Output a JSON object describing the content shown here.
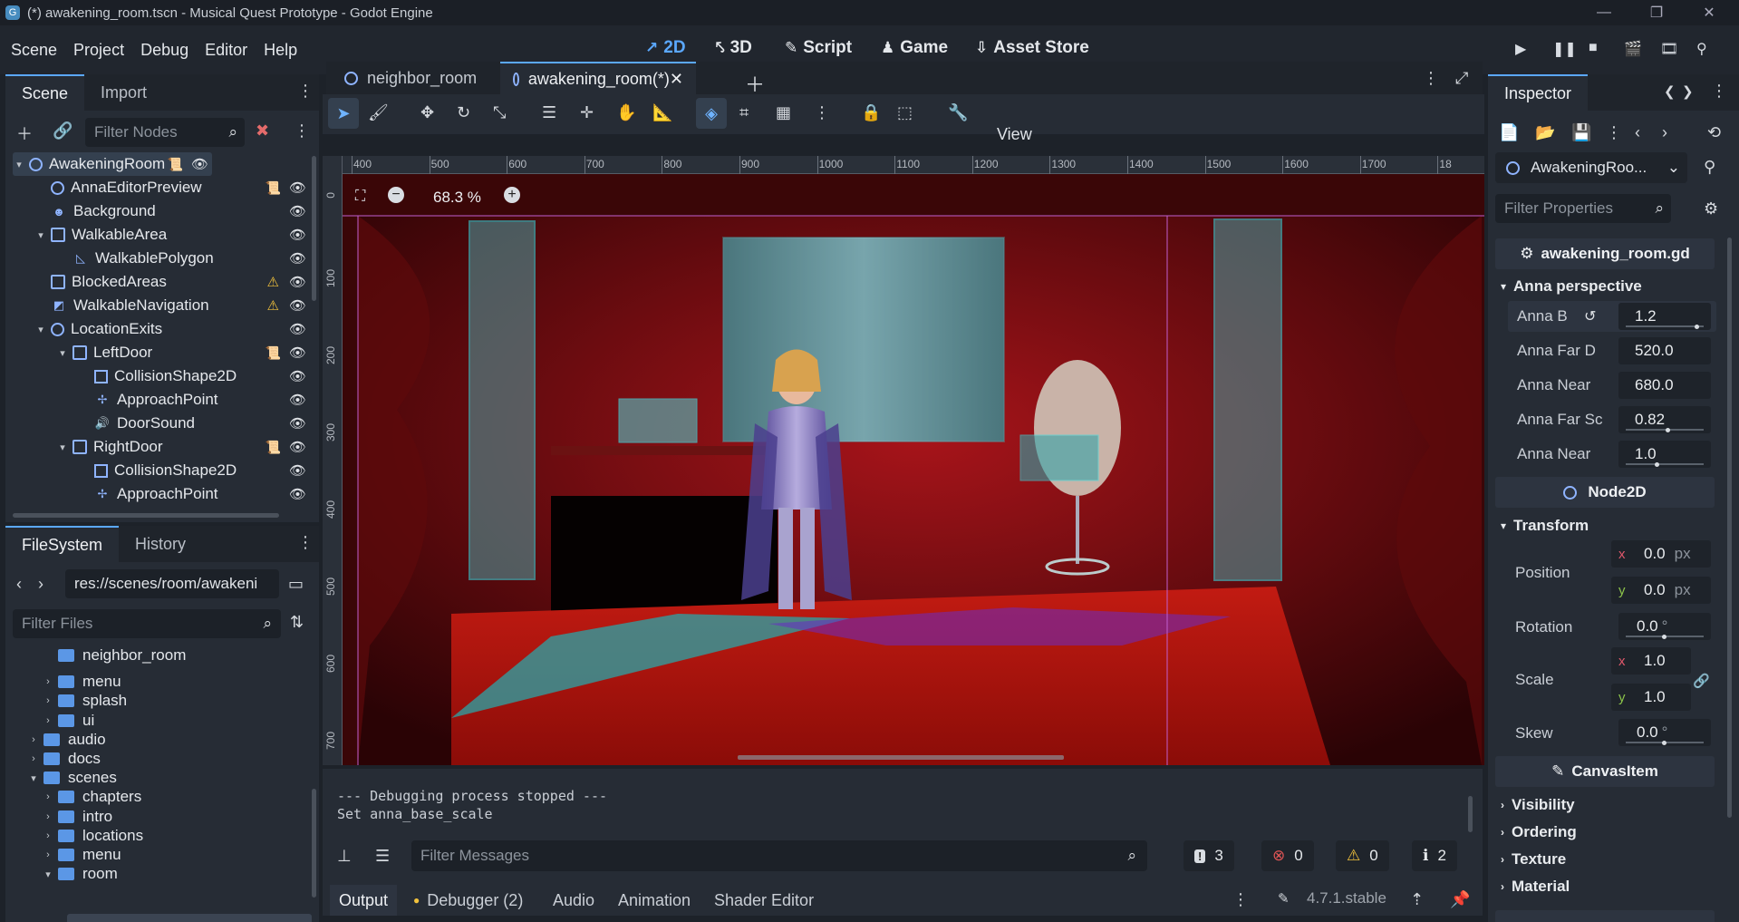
{
  "window": {
    "title": "(*) awakening_room.tscn - Musical Quest Prototype - Godot Engine"
  },
  "menu": [
    "Scene",
    "Project",
    "Debug",
    "Editor",
    "Help"
  ],
  "workspaces": [
    {
      "label": "2D",
      "glyph": "↗"
    },
    {
      "label": "3D",
      "glyph": "⤣"
    },
    {
      "label": "Script",
      "glyph": "✎"
    },
    {
      "label": "Game",
      "glyph": "♟"
    },
    {
      "label": "Asset Store",
      "glyph": "⇩"
    }
  ],
  "scene_dock": {
    "tabs": [
      "Scene",
      "Import"
    ],
    "filter_placeholder": "Filter Nodes",
    "nodes": [
      {
        "name": "AwakeningRoom",
        "depth": 0,
        "icon": "circle",
        "arrow": "▾",
        "script": true,
        "selected": true
      },
      {
        "name": "AnnaEditorPreview",
        "depth": 1,
        "icon": "circle",
        "script": true
      },
      {
        "name": "Background",
        "depth": 1,
        "icon": "sprite"
      },
      {
        "name": "WalkableArea",
        "depth": 1,
        "icon": "area",
        "arrow": "▾"
      },
      {
        "name": "WalkablePolygon",
        "depth": 2,
        "icon": "poly"
      },
      {
        "name": "BlockedAreas",
        "depth": 1,
        "icon": "area",
        "warn": true
      },
      {
        "name": "WalkableNavigation",
        "depth": 1,
        "icon": "nav",
        "warn": true
      },
      {
        "name": "LocationExits",
        "depth": 1,
        "icon": "circle",
        "arrow": "▾"
      },
      {
        "name": "LeftDoor",
        "depth": 2,
        "icon": "area",
        "arrow": "▾",
        "script": true
      },
      {
        "name": "CollisionShape2D",
        "depth": 3,
        "icon": "box"
      },
      {
        "name": "ApproachPoint",
        "depth": 3,
        "icon": "marker"
      },
      {
        "name": "DoorSound",
        "depth": 3,
        "icon": "sound"
      },
      {
        "name": "RightDoor",
        "depth": 2,
        "icon": "area",
        "arrow": "▾",
        "script": true
      },
      {
        "name": "CollisionShape2D",
        "depth": 3,
        "icon": "box"
      },
      {
        "name": "ApproachPoint",
        "depth": 3,
        "icon": "marker"
      }
    ]
  },
  "filesystem": {
    "tabs": [
      "FileSystem",
      "History"
    ],
    "path": "res://scenes/room/awakeni",
    "filter_placeholder": "Filter Files",
    "items": [
      {
        "name": "neighbor_room",
        "depth": 2,
        "arrow": ""
      },
      {
        "name": "menu",
        "depth": 2,
        "arrow": "›"
      },
      {
        "name": "splash",
        "depth": 2,
        "arrow": "›"
      },
      {
        "name": "ui",
        "depth": 2,
        "arrow": "›"
      },
      {
        "name": "audio",
        "depth": 1,
        "arrow": "›"
      },
      {
        "name": "docs",
        "depth": 1,
        "arrow": "›"
      },
      {
        "name": "scenes",
        "depth": 1,
        "arrow": "▾"
      },
      {
        "name": "chapters",
        "depth": 2,
        "arrow": "›"
      },
      {
        "name": "intro",
        "depth": 2,
        "arrow": "›"
      },
      {
        "name": "locations",
        "depth": 2,
        "arrow": "›"
      },
      {
        "name": "menu",
        "depth": 2,
        "arrow": "›"
      },
      {
        "name": "room",
        "depth": 2,
        "arrow": "▾"
      }
    ]
  },
  "editor_tabs": [
    {
      "label": "neighbor_room"
    },
    {
      "label": "awakening_room(*)",
      "active": true
    }
  ],
  "toolbar": {
    "view_label": "View",
    "zoom": "68.3 %"
  },
  "ruler": {
    "h": [
      "400",
      "500",
      "600",
      "700",
      "800",
      "900",
      "1000",
      "1100",
      "1200",
      "1300",
      "1400",
      "1500",
      "1600",
      "1700",
      "18"
    ],
    "v": [
      "0",
      "100",
      "200",
      "300",
      "400",
      "500",
      "600",
      "700"
    ]
  },
  "output": {
    "lines": [
      "--- Debugging process stopped ---",
      "Set anna_base_scale"
    ],
    "filter_placeholder": "Filter Messages",
    "counts": {
      "messages": "3",
      "errors": "0",
      "warnings": "0",
      "info": "2"
    }
  },
  "bottom_tabs": [
    "Output",
    "Debugger (2)",
    "Audio",
    "Animation",
    "Shader Editor"
  ],
  "version": "4.7.1.stable",
  "inspector": {
    "tab": "Inspector",
    "object": "AwakeningRoo...",
    "filter_placeholder": "Filter Properties",
    "script": "awakening_room.gd",
    "group_anna": "Anna perspective",
    "props": [
      {
        "label": "Anna B",
        "value": "1.2",
        "slider": 0.95,
        "revert": true
      },
      {
        "label": "Anna Far D",
        "value": "520.0"
      },
      {
        "label": "Anna Near",
        "value": "680.0"
      },
      {
        "label": "Anna Far Sc",
        "value": "0.82",
        "slider": 0.55
      },
      {
        "label": "Anna Near",
        "value": "1.0",
        "slider": 0.4
      }
    ],
    "node2d": "Node2D",
    "transform": "Transform",
    "position": {
      "label": "Position",
      "x": "0.0",
      "y": "0.0",
      "unit": "px"
    },
    "rotation": {
      "label": "Rotation",
      "value": "0.0",
      "unit": "°"
    },
    "scale": {
      "label": "Scale",
      "x": "1.0",
      "y": "1.0"
    },
    "skew": {
      "label": "Skew",
      "value": "0.0",
      "unit": "°"
    },
    "canvasitem": "CanvasItem",
    "sections": [
      "Visibility",
      "Ordering",
      "Texture",
      "Material"
    ]
  },
  "colors": {
    "accent": "#5ba8ff",
    "warning": "#f2c23c",
    "error": "#e05555"
  }
}
